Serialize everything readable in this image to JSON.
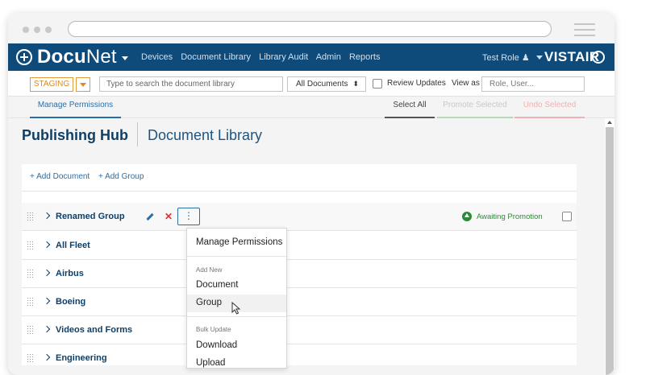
{
  "nav": {
    "brand_bold": "Docu",
    "brand_light": "Net",
    "links": [
      "Devices",
      "Document Library",
      "Library Audit",
      "Admin",
      "Reports"
    ],
    "role": "Test Role",
    "partner": "VISTAIR"
  },
  "toolbar": {
    "environment": "STAGING",
    "search_placeholder": "Type to search the document library",
    "filter_value": "All Documents",
    "review_label": "Review Updates",
    "view_as_label": "View as",
    "view_as_placeholder": "Role, User..."
  },
  "tabs": {
    "manage": "Manage Permissions",
    "select_all": "Select All",
    "promote": "Promote Selected",
    "undo": "Undo Selected"
  },
  "hub": {
    "title": "Publishing Hub",
    "subtitle": "Document Library"
  },
  "actions": {
    "add_document": "+ Add Document",
    "add_group": "+ Add Group"
  },
  "rows": [
    {
      "label": "Renamed Group",
      "status": "Awaiting Promotion"
    },
    {
      "label": "All Fleet"
    },
    {
      "label": "Airbus"
    },
    {
      "label": "Boeing"
    },
    {
      "label": "Videos and Forms"
    },
    {
      "label": "Engineering"
    }
  ],
  "menu": {
    "manage": "Manage Permissions",
    "add_new_header": "Add New",
    "document": "Document",
    "group": "Group",
    "bulk_header": "Bulk Update",
    "download": "Download",
    "upload": "Upload"
  },
  "colors": {
    "nav_bg": "#0e4a7a",
    "accent": "#2a6ea8",
    "staging": "#e08a22",
    "status_green": "#2d8a36",
    "delete_red": "#e0302e"
  }
}
